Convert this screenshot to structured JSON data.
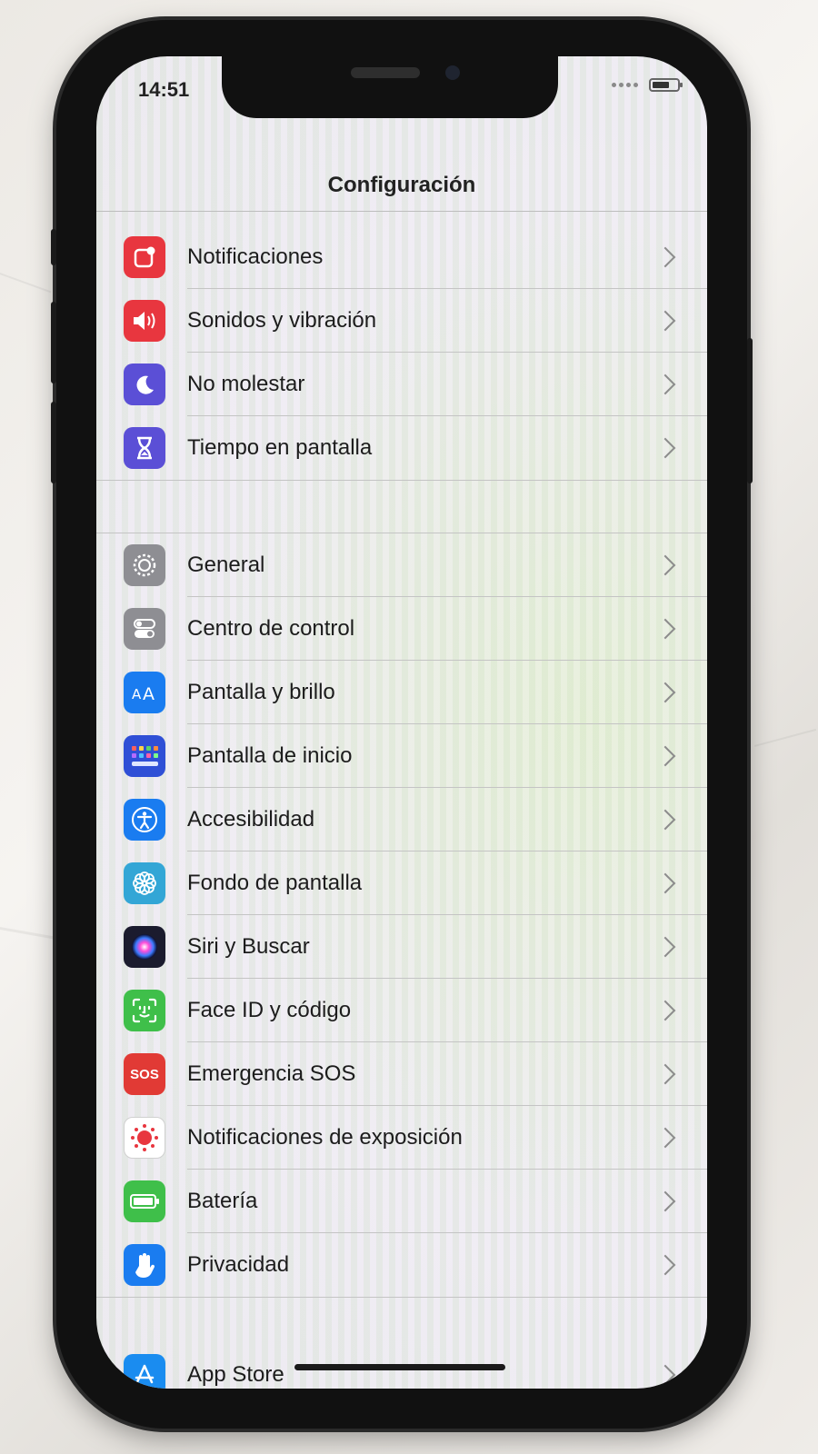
{
  "status_bar": {
    "time": "14:51",
    "battery_level": 0.7
  },
  "header": {
    "title": "Configuración"
  },
  "colors": {
    "red": "#e8363f",
    "purple": "#5b4fd6",
    "gray": "#8e8e93",
    "blue": "#1a7cf0",
    "teal": "#33a6d6",
    "green": "#3fbf4a",
    "orange_red": "#e13a35"
  },
  "groups": [
    {
      "items": [
        {
          "id": "notificaciones",
          "label": "Notificaciones",
          "icon": "notifications-icon",
          "color": "#e8363f"
        },
        {
          "id": "sonidos",
          "label": "Sonidos y vibración",
          "icon": "speaker-icon",
          "color": "#e8363f"
        },
        {
          "id": "no-molestar",
          "label": "No molestar",
          "icon": "moon-icon",
          "color": "#5b4fd6"
        },
        {
          "id": "tiempo-pantalla",
          "label": "Tiempo en pantalla",
          "icon": "hourglass-icon",
          "color": "#5b4fd6"
        }
      ]
    },
    {
      "items": [
        {
          "id": "general",
          "label": "General",
          "icon": "gear-icon",
          "color": "#8e8e93"
        },
        {
          "id": "centro-control",
          "label": "Centro de control",
          "icon": "toggles-icon",
          "color": "#8e8e93"
        },
        {
          "id": "pantalla-brillo",
          "label": "Pantalla y brillo",
          "icon": "text-size-icon",
          "color": "#1a7cf0"
        },
        {
          "id": "pantalla-inicio",
          "label": "Pantalla de inicio",
          "icon": "app-grid-icon",
          "color": "#2f4fd6"
        },
        {
          "id": "accesibilidad",
          "label": "Accesibilidad",
          "icon": "accessibility-icon",
          "color": "#1a7cf0"
        },
        {
          "id": "fondo-pantalla",
          "label": "Fondo de pantalla",
          "icon": "flower-icon",
          "color": "#33a6d6"
        },
        {
          "id": "siri",
          "label": "Siri y Buscar",
          "icon": "siri-icon",
          "color": "#1b1b2e"
        },
        {
          "id": "face-id",
          "label": "Face ID y código",
          "icon": "face-id-icon",
          "color": "#3fbf4a"
        },
        {
          "id": "sos",
          "label": "Emergencia SOS",
          "icon": "sos-icon",
          "sos_text": "SOS",
          "color": "#e13a35"
        },
        {
          "id": "exposicion",
          "label": "Notificaciones de exposición",
          "icon": "exposure-icon",
          "color": "#ffffff"
        },
        {
          "id": "bateria",
          "label": "Batería",
          "icon": "battery-icon",
          "color": "#3fbf4a"
        },
        {
          "id": "privacidad",
          "label": "Privacidad",
          "icon": "hand-icon",
          "color": "#1a7cf0"
        }
      ]
    },
    {
      "items": [
        {
          "id": "app-store",
          "label": "App Store",
          "icon": "app-store-icon",
          "color": "#1a8cf0"
        }
      ]
    }
  ]
}
